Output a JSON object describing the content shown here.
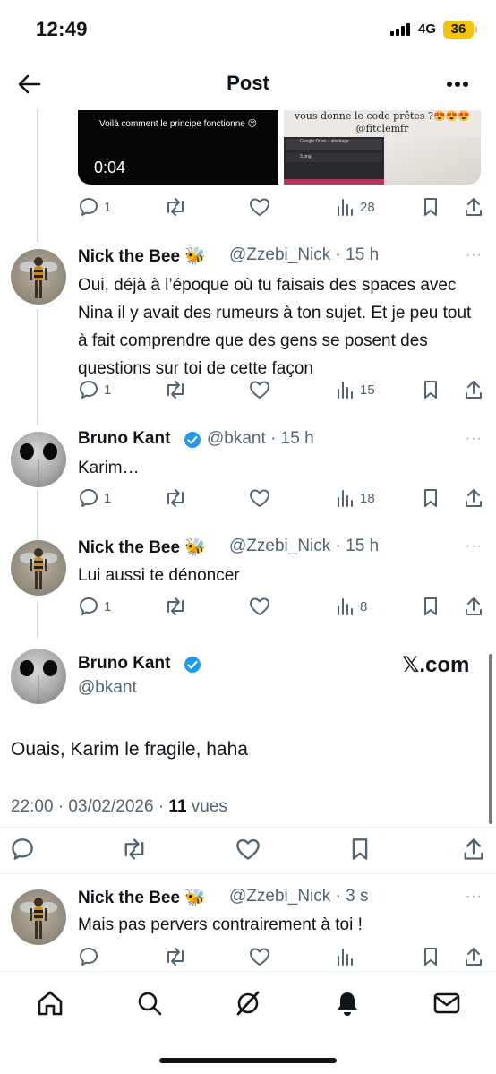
{
  "status_bar": {
    "time": "12:49",
    "network": "4G",
    "battery": "36"
  },
  "header": {
    "title": "Post"
  },
  "media": {
    "left_caption": "Voilà comment le principe fonctionne 😉",
    "duration": "0:04",
    "right_caption_line1": "vous donne le code prêtes ?😍😍😍",
    "right_caption_line2": "@fitclemfr",
    "app_title": "Google Drive – stockage",
    "file_name": "3.png"
  },
  "first_actions": {
    "replies": "1",
    "views": "28"
  },
  "tweets": [
    {
      "name": "Nick the Bee 🐝",
      "handle": "@Zzebi_Nick",
      "time": "· 15 h",
      "text": "Oui, déjà à l’époque où tu faisais des spaces avec Nina il y avait des rumeurs à ton sujet. Et je peu tout à fait comprendre que des gens se posent des questions sur toi de cette façon",
      "replies": "1",
      "views": "15"
    },
    {
      "name": "Bruno Kant",
      "handle": "@bkant",
      "time": "· 15 h",
      "text": "Karim…",
      "replies": "1",
      "views": "18"
    },
    {
      "name": "Nick the Bee 🐝",
      "handle": "@Zzebi_Nick",
      "time": "· 15 h",
      "text": "Lui aussi te dénoncer",
      "replies": "1",
      "views": "8"
    }
  ],
  "main_post": {
    "name": "Bruno Kant",
    "handle": "@bkant",
    "watermark": "𝕏.com",
    "text": "Ouais, Karim le fragile, haha",
    "timestamp": "22:00 · 03/02/2026 · ",
    "views_count": "11",
    "views_label": "vues"
  },
  "last_reply": {
    "name": "Nick the Bee 🐝",
    "handle": "@Zzebi_Nick",
    "time": "· 3 s",
    "text": "Mais pas pervers contrairement à toi !"
  },
  "more_glyph": "···",
  "colors": {
    "verified": "#1d9bf0",
    "text": "#0f1419",
    "muted": "#536471",
    "battery": "#f5c400"
  }
}
